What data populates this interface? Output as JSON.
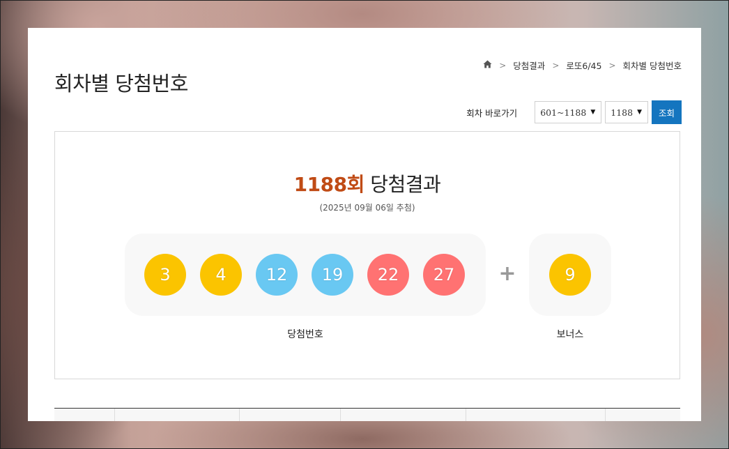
{
  "header": {
    "title": "회차별 당첨번호"
  },
  "breadcrumb": {
    "items": [
      "당첨결과",
      "로또6/45",
      "회차별 당첨번호"
    ]
  },
  "jump": {
    "label": "회차 바로가기",
    "range_select": "601~1188",
    "round_select": "1188",
    "button_label": "조회"
  },
  "result": {
    "round": "1188회",
    "title_suffix": "당첨결과",
    "date": "(2025년 09월 06일 추첨)",
    "winning_label": "당첨번호",
    "bonus_label": "보너스",
    "plus": "+",
    "numbers": [
      {
        "value": "3",
        "color": "#fbc400"
      },
      {
        "value": "4",
        "color": "#fbc400"
      },
      {
        "value": "12",
        "color": "#69c8f2"
      },
      {
        "value": "19",
        "color": "#69c8f2"
      },
      {
        "value": "22",
        "color": "#ff7272"
      },
      {
        "value": "27",
        "color": "#ff7272"
      }
    ],
    "bonus": {
      "value": "9",
      "color": "#fbc400"
    }
  },
  "colors": {
    "accent": "#1475bf",
    "round_highlight": "#c04b15"
  }
}
